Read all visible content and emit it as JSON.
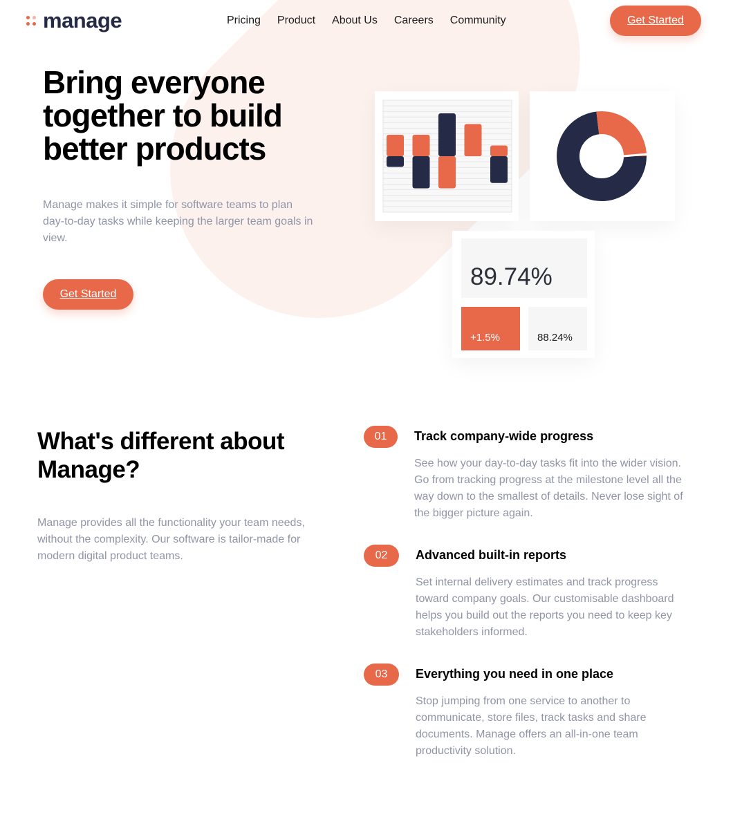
{
  "header": {
    "logo_text": "manage",
    "nav": [
      "Pricing",
      "Product",
      "About Us",
      "Careers",
      "Community"
    ],
    "cta_label": "Get Started"
  },
  "hero": {
    "title": "Bring everyone together to build better products",
    "text": "Manage makes it simple for software teams to plan day-to-day tasks while keeping the larger team goals in view.",
    "cta_label": "Get Started"
  },
  "stats": {
    "main": "89.74%",
    "change": "+1.5%",
    "secondary": "88.24%"
  },
  "chart_data": [
    {
      "type": "bar",
      "series": [
        {
          "name": "",
          "values": [
            -1,
            -3,
            4,
            1,
            -2.5
          ]
        },
        {
          "name": "",
          "values": [
            2,
            2,
            -3,
            3,
            1
          ]
        }
      ],
      "categories": [
        "",
        "",
        "",
        "",
        ""
      ]
    },
    {
      "type": "pie",
      "values": [
        73,
        27
      ],
      "colors": [
        "#252b46",
        "#e7694a"
      ]
    }
  ],
  "features_section": {
    "title": "What's different about Manage?",
    "text": "Manage provides all the functionality your team needs, without the complexity. Our software is tailor-made for modern digital product teams.",
    "items": [
      {
        "num": "01",
        "title": "Track company-wide progress",
        "text": "See how your day-to-day tasks fit into the wider vision. Go from tracking progress at the milestone level all the way down to the smallest of details. Never lose sight of the bigger picture again."
      },
      {
        "num": "02",
        "title": "Advanced built-in reports",
        "text": "Set internal delivery estimates and track progress toward company goals. Our customisable dashboard helps you build out the reports you need to keep key stakeholders informed."
      },
      {
        "num": "03",
        "title": "Everything you need in one place",
        "text": "Stop jumping from one service to another to communicate, store files, track tasks and share documents. Manage offers an all-in-one team productivity solution."
      }
    ]
  },
  "colors": {
    "accent": "#e7694a",
    "navy": "#252b46",
    "muted_text": "#9095a7",
    "shape": "#fdf1ee"
  }
}
